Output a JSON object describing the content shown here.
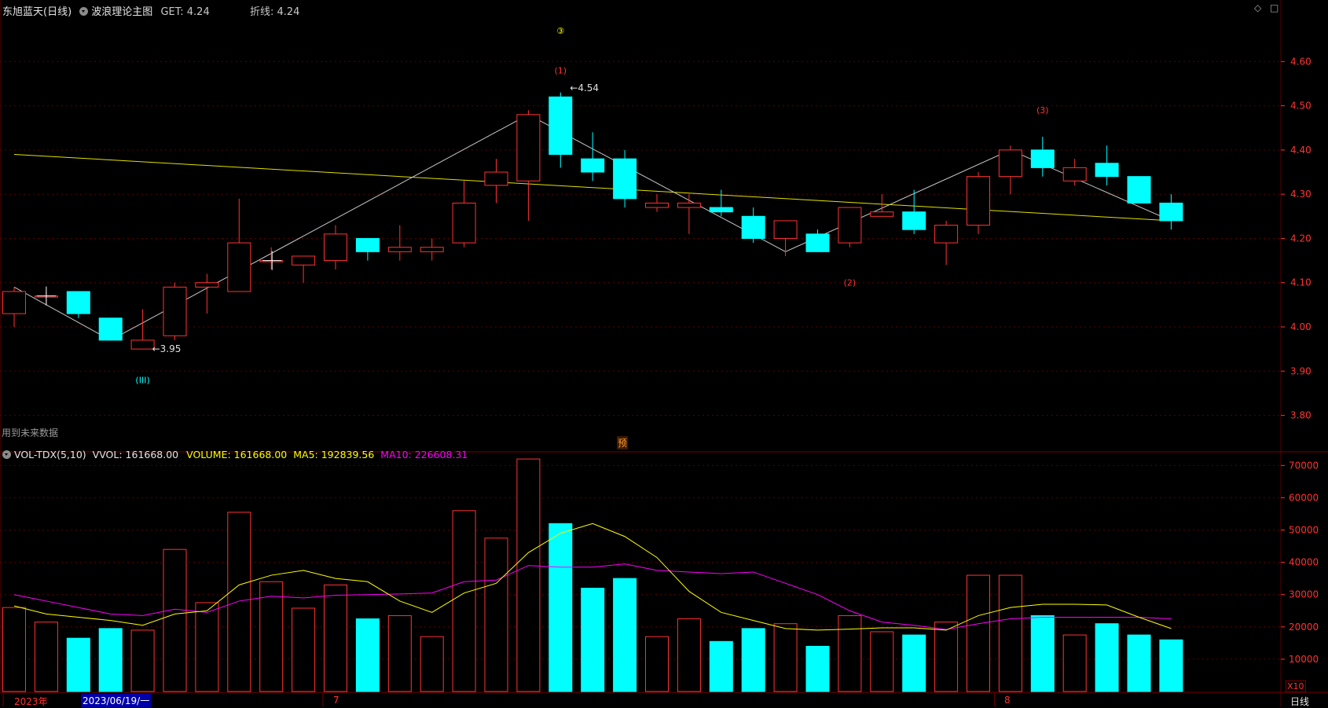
{
  "header": {
    "stock_label": "东旭蓝天(日线)",
    "indicator_name": "波浪理论主图",
    "get_text": "GET: 4.24",
    "polyline_text": "折线: 4.24"
  },
  "future_data_note": "用到未来数据",
  "pred_marker": "预",
  "volume_header": {
    "name": "VOL-TDX(5,10)",
    "vvol": "VVOL: 161668.00",
    "volume": "VOLUME: 161668.00",
    "ma5": "MA5: 192839.56",
    "ma10": "MA10: 226608.31"
  },
  "bottom_axis": {
    "year_label": "2023年",
    "cursor_date": "2023/06/19/一",
    "month_labels": [
      "7",
      "8"
    ],
    "period_label": "日线",
    "vol_unit": "X10"
  },
  "window_controls": [
    "◇",
    "□"
  ],
  "colors": {
    "up": "#ff3232",
    "down": "#00ffff",
    "ma5": "#ffff00",
    "ma10": "#ff00ff",
    "trendline": "#e0e000",
    "zigzag": "#c8c8c8",
    "grid": "#5a0000",
    "axis_text": "#ff3232"
  },
  "chart_data": {
    "type": "candlestick",
    "price_axis": {
      "ylim": [
        3.73,
        4.7
      ],
      "ticks": [
        3.8,
        3.9,
        4.0,
        4.1,
        4.2,
        4.3,
        4.4,
        4.5,
        4.6
      ]
    },
    "candles": [
      {
        "o": 4.03,
        "h": 4.09,
        "l": 4.0,
        "c": 4.08
      },
      {
        "o": 4.07,
        "h": 4.08,
        "l": 4.05,
        "c": 4.07
      },
      {
        "o": 4.08,
        "h": 4.08,
        "l": 4.02,
        "c": 4.03
      },
      {
        "o": 4.02,
        "h": 4.02,
        "l": 3.97,
        "c": 3.97
      },
      {
        "o": 3.95,
        "h": 4.04,
        "l": 3.95,
        "c": 3.97
      },
      {
        "o": 3.98,
        "h": 4.1,
        "l": 3.97,
        "c": 4.09
      },
      {
        "o": 4.09,
        "h": 4.12,
        "l": 4.03,
        "c": 4.1
      },
      {
        "o": 4.08,
        "h": 4.29,
        "l": 4.08,
        "c": 4.19
      },
      {
        "o": 4.15,
        "h": 4.18,
        "l": 4.13,
        "c": 4.15
      },
      {
        "o": 4.14,
        "h": 4.16,
        "l": 4.1,
        "c": 4.16
      },
      {
        "o": 4.15,
        "h": 4.23,
        "l": 4.13,
        "c": 4.21
      },
      {
        "o": 4.2,
        "h": 4.2,
        "l": 4.15,
        "c": 4.17
      },
      {
        "o": 4.17,
        "h": 4.23,
        "l": 4.15,
        "c": 4.18
      },
      {
        "o": 4.17,
        "h": 4.2,
        "l": 4.15,
        "c": 4.18
      },
      {
        "o": 4.19,
        "h": 4.33,
        "l": 4.18,
        "c": 4.28
      },
      {
        "o": 4.32,
        "h": 4.38,
        "l": 4.28,
        "c": 4.35
      },
      {
        "o": 4.33,
        "h": 4.49,
        "l": 4.24,
        "c": 4.48
      },
      {
        "o": 4.52,
        "h": 4.53,
        "l": 4.36,
        "c": 4.39
      },
      {
        "o": 4.38,
        "h": 4.44,
        "l": 4.33,
        "c": 4.35
      },
      {
        "o": 4.38,
        "h": 4.4,
        "l": 4.27,
        "c": 4.29
      },
      {
        "o": 4.27,
        "h": 4.3,
        "l": 4.26,
        "c": 4.28
      },
      {
        "o": 4.27,
        "h": 4.3,
        "l": 4.21,
        "c": 4.28
      },
      {
        "o": 4.27,
        "h": 4.31,
        "l": 4.25,
        "c": 4.26
      },
      {
        "o": 4.25,
        "h": 4.27,
        "l": 4.19,
        "c": 4.2
      },
      {
        "o": 4.2,
        "h": 4.24,
        "l": 4.16,
        "c": 4.24
      },
      {
        "o": 4.21,
        "h": 4.22,
        "l": 4.17,
        "c": 4.17
      },
      {
        "o": 4.19,
        "h": 4.27,
        "l": 4.18,
        "c": 4.27
      },
      {
        "o": 4.25,
        "h": 4.3,
        "l": 4.25,
        "c": 4.26
      },
      {
        "o": 4.26,
        "h": 4.31,
        "l": 4.21,
        "c": 4.22
      },
      {
        "o": 4.19,
        "h": 4.24,
        "l": 4.14,
        "c": 4.23
      },
      {
        "o": 4.23,
        "h": 4.35,
        "l": 4.21,
        "c": 4.34
      },
      {
        "o": 4.34,
        "h": 4.41,
        "l": 4.3,
        "c": 4.4
      },
      {
        "o": 4.4,
        "h": 4.43,
        "l": 4.34,
        "c": 4.36
      },
      {
        "o": 4.33,
        "h": 4.38,
        "l": 4.32,
        "c": 4.36
      },
      {
        "o": 4.37,
        "h": 4.41,
        "l": 4.32,
        "c": 4.34
      },
      {
        "o": 4.34,
        "h": 4.34,
        "l": 4.28,
        "c": 4.28
      },
      {
        "o": 4.28,
        "h": 4.3,
        "l": 4.22,
        "c": 4.24
      }
    ],
    "volume_axis": {
      "ylim": [
        0,
        73000
      ],
      "ticks": [
        10000,
        20000,
        30000,
        40000,
        50000,
        60000,
        70000
      ]
    },
    "volumes": [
      26000,
      21500,
      16500,
      19500,
      19000,
      44000,
      27500,
      55500,
      34000,
      25800,
      33000,
      22500,
      23500,
      17000,
      56000,
      47500,
      72000,
      52000,
      32000,
      35000,
      17000,
      22500,
      15500,
      19500,
      21000,
      14000,
      23500,
      18500,
      17500,
      21500,
      36000,
      36000,
      23500,
      17500,
      21000,
      17500,
      16000
    ],
    "ma5": [
      26500,
      24000,
      23000,
      22000,
      20500,
      24000,
      25000,
      33000,
      36000,
      37500,
      35000,
      34000,
      28000,
      24500,
      30500,
      33500,
      43000,
      49000,
      52000,
      48000,
      41500,
      31000,
      24500,
      22000,
      19500,
      19000,
      19300,
      19700,
      19700,
      19000,
      23500,
      26000,
      27000,
      27000,
      26800,
      23000,
      19500
    ],
    "ma10": [
      30000,
      28000,
      26000,
      24000,
      23500,
      25500,
      24500,
      28000,
      29500,
      29000,
      29800,
      30000,
      30200,
      30500,
      34000,
      34500,
      39000,
      38500,
      38500,
      39500,
      37500,
      37000,
      36500,
      37000,
      33500,
      30000,
      25000,
      21500,
      20500,
      19200,
      21000,
      22500,
      23000,
      23000,
      23000,
      23000,
      22500
    ],
    "trendline": {
      "start": 4.39,
      "end": 4.24
    },
    "zigzag": [
      {
        "i": 0,
        "v": 4.09
      },
      {
        "i": 3,
        "v": 3.97
      },
      {
        "i": 16,
        "v": 4.48
      },
      {
        "i": 24,
        "v": 4.17
      },
      {
        "i": 31,
        "v": 4.4
      },
      {
        "i": 36,
        "v": 4.24
      }
    ],
    "annotations": [
      {
        "text": "③",
        "i": 17,
        "v": 4.67,
        "color": "#ffff00"
      },
      {
        "text": "(1)",
        "i": 17,
        "v": 4.58,
        "color": "#ff3232"
      },
      {
        "text": "(3)",
        "i": 32,
        "v": 4.49,
        "color": "#ff3232"
      },
      {
        "text": "(2)",
        "i": 26,
        "v": 4.1,
        "color": "#ff3232"
      },
      {
        "text": "(III)",
        "i": 4,
        "v": 3.88,
        "color": "#00ffff"
      },
      {
        "text": "←4.54",
        "i": 17,
        "v": 4.54,
        "color": "#e0e0e0"
      },
      {
        "text": "←3.95",
        "i": 4,
        "v": 3.95,
        "color": "#e0e0e0"
      }
    ]
  }
}
